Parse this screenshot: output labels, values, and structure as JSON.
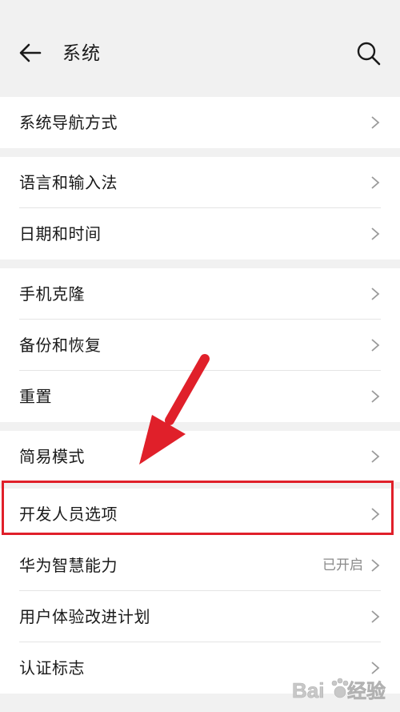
{
  "header": {
    "title": "系统",
    "back_icon": "back-arrow-icon",
    "search_icon": "search-icon"
  },
  "groups": [
    {
      "items": [
        {
          "label": "系统导航方式"
        }
      ]
    },
    {
      "items": [
        {
          "label": "语言和输入法"
        },
        {
          "label": "日期和时间"
        }
      ]
    },
    {
      "items": [
        {
          "label": "手机克隆"
        },
        {
          "label": "备份和恢复"
        },
        {
          "label": "重置"
        }
      ]
    },
    {
      "items": [
        {
          "label": "简易模式"
        },
        {
          "label": "开发人员选项"
        },
        {
          "label": "华为智慧能力",
          "status": "已开启"
        },
        {
          "label": "用户体验改进计划"
        },
        {
          "label": "认证标志"
        }
      ]
    }
  ],
  "annotation": {
    "highlight_color": "#e0202a",
    "arrow_color": "#e0202a"
  },
  "watermark": {
    "text": "Bai du 经验"
  },
  "colors": {
    "background": "#f1f1f1",
    "card": "#ffffff",
    "chevron": "#9a9a9a",
    "status": "#8a8a8a"
  }
}
